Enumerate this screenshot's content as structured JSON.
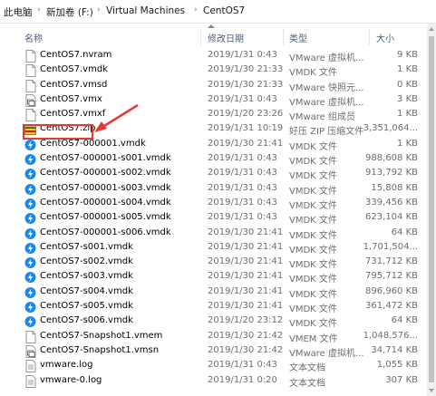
{
  "breadcrumb": {
    "items": [
      "此电脑",
      "新加卷 (F:)",
      "Virtual Machines",
      "CentOS7"
    ]
  },
  "columns": {
    "name": "名称",
    "date": "修改日期",
    "type": "类型",
    "size": "大小"
  },
  "files": [
    {
      "name": "CentOS7.nvram",
      "date": "2019/1/31 0:43",
      "type": "VMware 虚拟机...",
      "size": "9 KB",
      "icon": "nvram-file-icon"
    },
    {
      "name": "CentOS7.vmdk",
      "date": "2019/1/30 21:33",
      "type": "VMDK 文件",
      "size": "1 KB",
      "icon": "vmdk-file-icon"
    },
    {
      "name": "CentOS7.vmsd",
      "date": "2019/1/30 21:33",
      "type": "VMware 快照元...",
      "size": "0 KB",
      "icon": "vmsd-file-icon"
    },
    {
      "name": "CentOS7.vmx",
      "date": "2019/1/31 0:43",
      "type": "VMware 虚拟机...",
      "size": "3 KB",
      "icon": "vmx-file-icon"
    },
    {
      "name": "CentOS7.vmxf",
      "date": "2019/1/20 23:26",
      "type": "VMware 组成员",
      "size": "1 KB",
      "icon": "vmxf-file-icon"
    },
    {
      "name": "CentOS7.zip",
      "date": "2019/1/31 10:19",
      "type": "好压 ZIP 压缩文件",
      "size": "3,351,064...",
      "icon": "zip-archive-icon"
    },
    {
      "name": "CentOS7-000001.vmdk",
      "date": "2019/1/30 21:41",
      "type": "VMDK 文件",
      "size": "1 KB",
      "icon": "vmware-disk-icon"
    },
    {
      "name": "CentOS7-000001-s001.vmdk",
      "date": "2019/1/31 0:43",
      "type": "VMDK 文件",
      "size": "988,608 KB",
      "icon": "vmware-disk-icon"
    },
    {
      "name": "CentOS7-000001-s002.vmdk",
      "date": "2019/1/31 0:43",
      "type": "VMDK 文件",
      "size": "913,792 KB",
      "icon": "vmware-disk-icon"
    },
    {
      "name": "CentOS7-000001-s003.vmdk",
      "date": "2019/1/31 0:43",
      "type": "VMDK 文件",
      "size": "15,808 KB",
      "icon": "vmware-disk-icon"
    },
    {
      "name": "CentOS7-000001-s004.vmdk",
      "date": "2019/1/31 0:43",
      "type": "VMDK 文件",
      "size": "339,456 KB",
      "icon": "vmware-disk-icon"
    },
    {
      "name": "CentOS7-000001-s005.vmdk",
      "date": "2019/1/31 0:43",
      "type": "VMDK 文件",
      "size": "623,104 KB",
      "icon": "vmware-disk-icon"
    },
    {
      "name": "CentOS7-000001-s006.vmdk",
      "date": "2019/1/30 21:41",
      "type": "VMDK 文件",
      "size": "64 KB",
      "icon": "vmware-disk-icon"
    },
    {
      "name": "CentOS7-s001.vmdk",
      "date": "2019/1/30 21:41",
      "type": "VMDK 文件",
      "size": "1,701,504...",
      "icon": "vmware-disk-icon"
    },
    {
      "name": "CentOS7-s002.vmdk",
      "date": "2019/1/30 21:41",
      "type": "VMDK 文件",
      "size": "731,712 KB",
      "icon": "vmware-disk-icon"
    },
    {
      "name": "CentOS7-s003.vmdk",
      "date": "2019/1/30 21:41",
      "type": "VMDK 文件",
      "size": "795,712 KB",
      "icon": "vmware-disk-icon"
    },
    {
      "name": "CentOS7-s004.vmdk",
      "date": "2019/1/30 21:41",
      "type": "VMDK 文件",
      "size": "896,960 KB",
      "icon": "vmware-disk-icon"
    },
    {
      "name": "CentOS7-s005.vmdk",
      "date": "2019/1/30 21:41",
      "type": "VMDK 文件",
      "size": "361,472 KB",
      "icon": "vmware-disk-icon"
    },
    {
      "name": "CentOS7-s006.vmdk",
      "date": "2019/1/20 23:12",
      "type": "VMDK 文件",
      "size": "64 KB",
      "icon": "vmware-disk-icon"
    },
    {
      "name": "CentOS7-Snapshot1.vmem",
      "date": "2019/1/30 21:42",
      "type": "VMEM 文件",
      "size": "1,048,576...",
      "icon": "vmem-file-icon"
    },
    {
      "name": "CentOS7-Snapshot1.vmsn",
      "date": "2019/1/30 21:42",
      "type": "VMware 虚拟机...",
      "size": "34,714 KB",
      "icon": "vmsn-file-icon"
    },
    {
      "name": "vmware.log",
      "date": "2019/1/31 0:43",
      "type": "文本文档",
      "size": "1,055 KB",
      "icon": "log-file-icon"
    },
    {
      "name": "vmware-0.log",
      "date": "2019/1/31 0:20",
      "type": "文本文档",
      "size": "307 KB",
      "icon": "log-file-icon"
    }
  ],
  "colors": {
    "highlight": "#e53935",
    "header_text": "#4c607a",
    "vmware_blue": "#1e88e5",
    "zip_yellow": "#f4c430"
  }
}
